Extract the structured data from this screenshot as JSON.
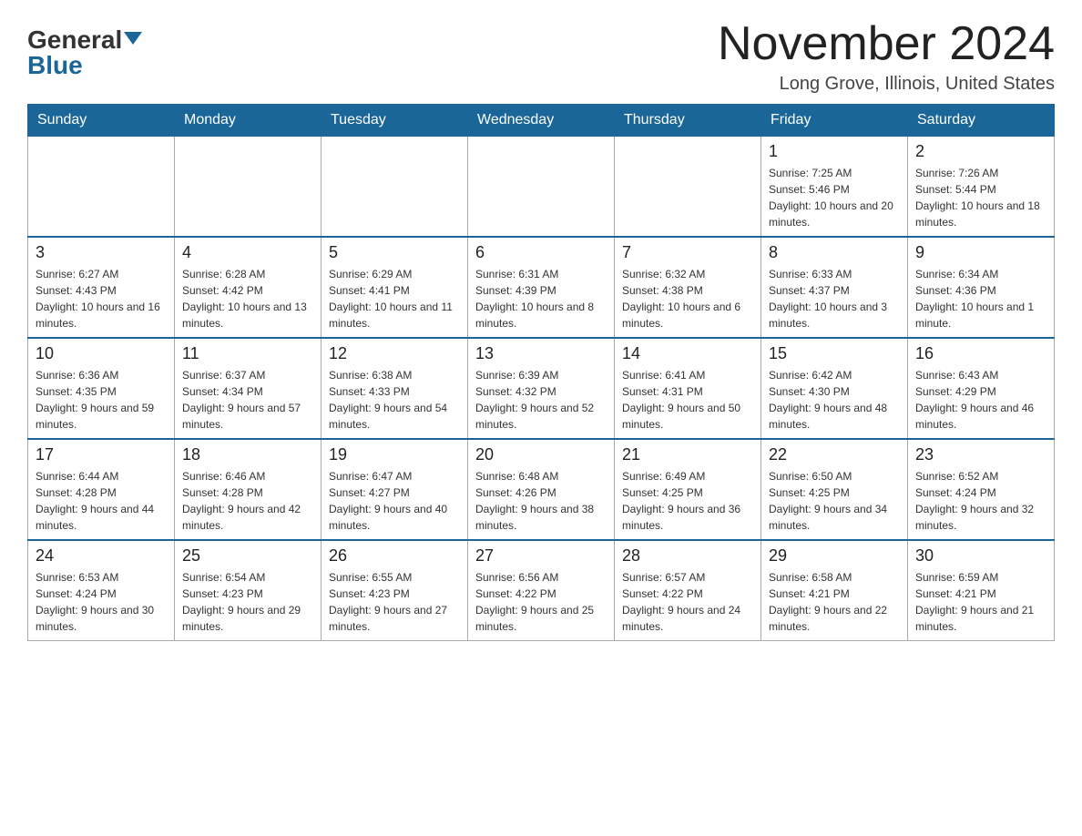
{
  "logo": {
    "general": "General",
    "blue": "Blue"
  },
  "title": "November 2024",
  "location": "Long Grove, Illinois, United States",
  "days_of_week": [
    "Sunday",
    "Monday",
    "Tuesday",
    "Wednesday",
    "Thursday",
    "Friday",
    "Saturday"
  ],
  "weeks": [
    {
      "days": [
        {
          "number": "",
          "sunrise": "",
          "sunset": "",
          "daylight": ""
        },
        {
          "number": "",
          "sunrise": "",
          "sunset": "",
          "daylight": ""
        },
        {
          "number": "",
          "sunrise": "",
          "sunset": "",
          "daylight": ""
        },
        {
          "number": "",
          "sunrise": "",
          "sunset": "",
          "daylight": ""
        },
        {
          "number": "",
          "sunrise": "",
          "sunset": "",
          "daylight": ""
        },
        {
          "number": "1",
          "sunrise": "Sunrise: 7:25 AM",
          "sunset": "Sunset: 5:46 PM",
          "daylight": "Daylight: 10 hours and 20 minutes."
        },
        {
          "number": "2",
          "sunrise": "Sunrise: 7:26 AM",
          "sunset": "Sunset: 5:44 PM",
          "daylight": "Daylight: 10 hours and 18 minutes."
        }
      ]
    },
    {
      "days": [
        {
          "number": "3",
          "sunrise": "Sunrise: 6:27 AM",
          "sunset": "Sunset: 4:43 PM",
          "daylight": "Daylight: 10 hours and 16 minutes."
        },
        {
          "number": "4",
          "sunrise": "Sunrise: 6:28 AM",
          "sunset": "Sunset: 4:42 PM",
          "daylight": "Daylight: 10 hours and 13 minutes."
        },
        {
          "number": "5",
          "sunrise": "Sunrise: 6:29 AM",
          "sunset": "Sunset: 4:41 PM",
          "daylight": "Daylight: 10 hours and 11 minutes."
        },
        {
          "number": "6",
          "sunrise": "Sunrise: 6:31 AM",
          "sunset": "Sunset: 4:39 PM",
          "daylight": "Daylight: 10 hours and 8 minutes."
        },
        {
          "number": "7",
          "sunrise": "Sunrise: 6:32 AM",
          "sunset": "Sunset: 4:38 PM",
          "daylight": "Daylight: 10 hours and 6 minutes."
        },
        {
          "number": "8",
          "sunrise": "Sunrise: 6:33 AM",
          "sunset": "Sunset: 4:37 PM",
          "daylight": "Daylight: 10 hours and 3 minutes."
        },
        {
          "number": "9",
          "sunrise": "Sunrise: 6:34 AM",
          "sunset": "Sunset: 4:36 PM",
          "daylight": "Daylight: 10 hours and 1 minute."
        }
      ]
    },
    {
      "days": [
        {
          "number": "10",
          "sunrise": "Sunrise: 6:36 AM",
          "sunset": "Sunset: 4:35 PM",
          "daylight": "Daylight: 9 hours and 59 minutes."
        },
        {
          "number": "11",
          "sunrise": "Sunrise: 6:37 AM",
          "sunset": "Sunset: 4:34 PM",
          "daylight": "Daylight: 9 hours and 57 minutes."
        },
        {
          "number": "12",
          "sunrise": "Sunrise: 6:38 AM",
          "sunset": "Sunset: 4:33 PM",
          "daylight": "Daylight: 9 hours and 54 minutes."
        },
        {
          "number": "13",
          "sunrise": "Sunrise: 6:39 AM",
          "sunset": "Sunset: 4:32 PM",
          "daylight": "Daylight: 9 hours and 52 minutes."
        },
        {
          "number": "14",
          "sunrise": "Sunrise: 6:41 AM",
          "sunset": "Sunset: 4:31 PM",
          "daylight": "Daylight: 9 hours and 50 minutes."
        },
        {
          "number": "15",
          "sunrise": "Sunrise: 6:42 AM",
          "sunset": "Sunset: 4:30 PM",
          "daylight": "Daylight: 9 hours and 48 minutes."
        },
        {
          "number": "16",
          "sunrise": "Sunrise: 6:43 AM",
          "sunset": "Sunset: 4:29 PM",
          "daylight": "Daylight: 9 hours and 46 minutes."
        }
      ]
    },
    {
      "days": [
        {
          "number": "17",
          "sunrise": "Sunrise: 6:44 AM",
          "sunset": "Sunset: 4:28 PM",
          "daylight": "Daylight: 9 hours and 44 minutes."
        },
        {
          "number": "18",
          "sunrise": "Sunrise: 6:46 AM",
          "sunset": "Sunset: 4:28 PM",
          "daylight": "Daylight: 9 hours and 42 minutes."
        },
        {
          "number": "19",
          "sunrise": "Sunrise: 6:47 AM",
          "sunset": "Sunset: 4:27 PM",
          "daylight": "Daylight: 9 hours and 40 minutes."
        },
        {
          "number": "20",
          "sunrise": "Sunrise: 6:48 AM",
          "sunset": "Sunset: 4:26 PM",
          "daylight": "Daylight: 9 hours and 38 minutes."
        },
        {
          "number": "21",
          "sunrise": "Sunrise: 6:49 AM",
          "sunset": "Sunset: 4:25 PM",
          "daylight": "Daylight: 9 hours and 36 minutes."
        },
        {
          "number": "22",
          "sunrise": "Sunrise: 6:50 AM",
          "sunset": "Sunset: 4:25 PM",
          "daylight": "Daylight: 9 hours and 34 minutes."
        },
        {
          "number": "23",
          "sunrise": "Sunrise: 6:52 AM",
          "sunset": "Sunset: 4:24 PM",
          "daylight": "Daylight: 9 hours and 32 minutes."
        }
      ]
    },
    {
      "days": [
        {
          "number": "24",
          "sunrise": "Sunrise: 6:53 AM",
          "sunset": "Sunset: 4:24 PM",
          "daylight": "Daylight: 9 hours and 30 minutes."
        },
        {
          "number": "25",
          "sunrise": "Sunrise: 6:54 AM",
          "sunset": "Sunset: 4:23 PM",
          "daylight": "Daylight: 9 hours and 29 minutes."
        },
        {
          "number": "26",
          "sunrise": "Sunrise: 6:55 AM",
          "sunset": "Sunset: 4:23 PM",
          "daylight": "Daylight: 9 hours and 27 minutes."
        },
        {
          "number": "27",
          "sunrise": "Sunrise: 6:56 AM",
          "sunset": "Sunset: 4:22 PM",
          "daylight": "Daylight: 9 hours and 25 minutes."
        },
        {
          "number": "28",
          "sunrise": "Sunrise: 6:57 AM",
          "sunset": "Sunset: 4:22 PM",
          "daylight": "Daylight: 9 hours and 24 minutes."
        },
        {
          "number": "29",
          "sunrise": "Sunrise: 6:58 AM",
          "sunset": "Sunset: 4:21 PM",
          "daylight": "Daylight: 9 hours and 22 minutes."
        },
        {
          "number": "30",
          "sunrise": "Sunrise: 6:59 AM",
          "sunset": "Sunset: 4:21 PM",
          "daylight": "Daylight: 9 hours and 21 minutes."
        }
      ]
    }
  ]
}
